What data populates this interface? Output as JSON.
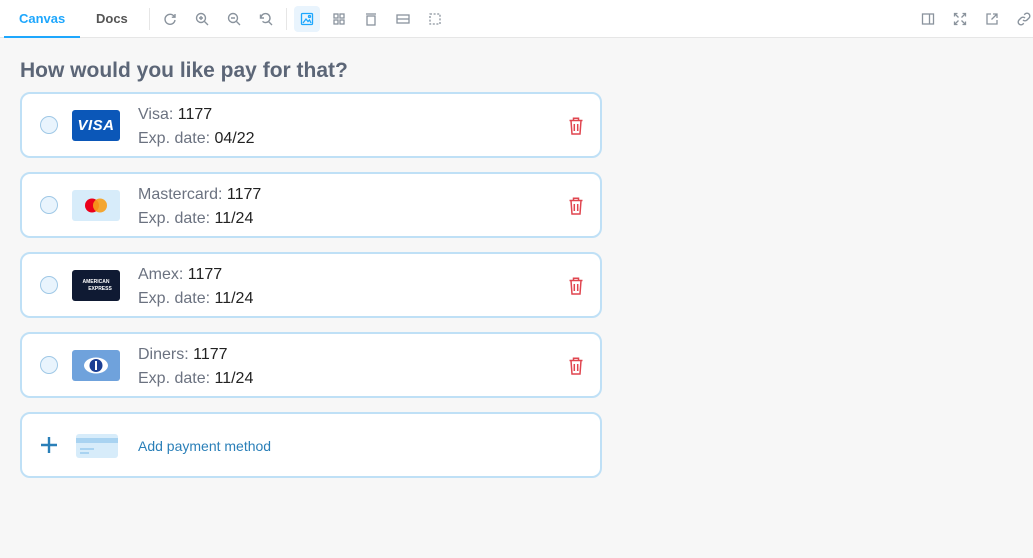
{
  "toolbar": {
    "tabs": [
      {
        "label": "Canvas",
        "active": true
      },
      {
        "label": "Docs",
        "active": false
      }
    ],
    "icons": [
      "reload-icon",
      "zoom-in-icon",
      "zoom-out-icon",
      "zoom-reset-icon",
      "background-icon",
      "grid-icon",
      "viewport-icon",
      "measure-icon",
      "outline-icon",
      "sidebar-icon",
      "fullscreen-icon",
      "open-new-tab-icon",
      "link-icon"
    ]
  },
  "page": {
    "heading": "How would you like pay for that?",
    "cards": [
      {
        "brand": "Visa",
        "brand_label": "Visa:",
        "number": "1177",
        "exp_label": "Exp. date:",
        "exp": "04/22",
        "logo_text": "VISA",
        "logo_bg": "#0b57b8"
      },
      {
        "brand": "Mastercard",
        "brand_label": "Mastercard:",
        "number": "1177",
        "exp_label": "Exp. date:",
        "exp": "11/24",
        "logo_bg": "#d7ecfa"
      },
      {
        "brand": "Amex",
        "brand_label": "Amex:",
        "number": "1177",
        "exp_label": "Exp. date:",
        "exp": "11/24",
        "logo_text_1": "AMERICAN",
        "logo_text_2": "EXPRESS",
        "logo_bg": "#0f1a33"
      },
      {
        "brand": "Diners",
        "brand_label": "Diners:",
        "number": "1177",
        "exp_label": "Exp. date:",
        "exp": "11/24",
        "logo_bg": "#6fa2dc"
      }
    ],
    "add_label": "Add payment method"
  },
  "colors": {
    "accent": "#1ea7fd",
    "card_border": "#bfe0f6",
    "delete": "#e0454f",
    "link": "#2a7fb8"
  }
}
